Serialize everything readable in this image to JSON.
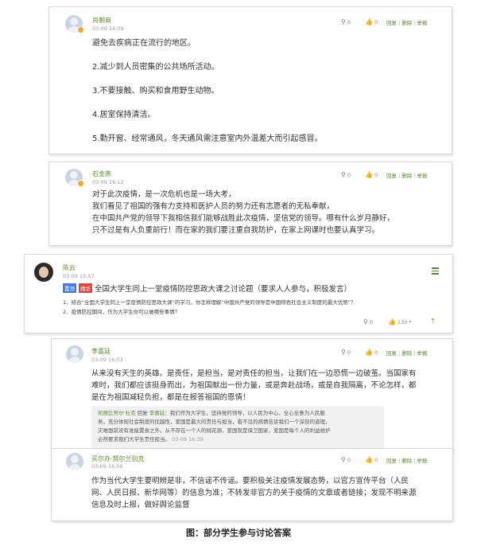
{
  "comments": [
    {
      "user": "肖朝商",
      "time": "03-09 16:09",
      "share_count": "0",
      "like_count": "0",
      "lines": [
        "避免去疾病正在流行的地区。",
        "2.减少到人员密集的公共场所活动。",
        "3.不要接触、购买和食用野生动物。",
        "4.居室保持清洁。",
        "5.勤开窗、经常通风，冬天通风需注意室内外温差大而引起感冒。"
      ]
    },
    {
      "user": "石金燕",
      "time": "03-09 16:12",
      "share_count": "0",
      "like_count": "0",
      "lines": [
        "对于此次疫情，是一次危机也是一场大考，",
        "我们看见了祖国的强有力支持和医护人员的努力还有志愿者的无私奉献，",
        "在中国共产党的领导下我相信我们能够战胜此次疫情，坚信党的领导。哪有什么岁月静好，",
        "只不过是有人负重前行！而在家的我们要注重自我防护，在家上网课时也要认真学习。"
      ]
    }
  ],
  "topic": {
    "user": "陈云",
    "time": "03-09 15:57",
    "tag_top": "置顶",
    "tag_hot": "精华",
    "title": "全国大学生同上一堂疫情防控思政大课之讨论题（要求人人参与，积极发言）",
    "desc1": "1、结合“全国大学生同上一堂疫情防控思政大课”的学习，你怎样理解“中国共产党的领导是中国特色社会主义制度的最大优势”？",
    "desc2": "2、疫情防控期间，作为大学生你可以做哪些事情？",
    "share_count": "0",
    "like_count": "130"
  },
  "replies": [
    {
      "user": "李喜廷",
      "time": "03-09 16:03",
      "share_count": "0",
      "like_count": "0",
      "lines": [
        "从来没有天生的英雄。是责任，是担当，是对责任的担当，让我们在一边恐慌一边破茧。当国家有",
        "难时，我们都应该挺身而出，为祖国献出一份力量，或是奔赴战场，或是自我隔离，不论怎样，都",
        "是在为祖国减轻负担，都是在报答祖国的恩情！"
      ],
      "quote": {
        "name": "凯丽比努尔·杜克",
        "reply_word": "回复",
        "target": "李喜廷",
        "text_lines": [
          "：我们作为大学生，坚持党的领导，以人民为中心，全心全意为人民服",
          "务，充分体现社会制度的优越性，爱国是最大的责任与担当，看不见的病情告诉我们一个深刻的道理，",
          "灾难面前没有谁能置身之外。从不存在一个人的桃花源，爱国就是保卫国家，爱国是每个人的利益维护",
          "必然要求我们大学生责任担当。"
        ],
        "time": "03-09 16:39"
      }
    },
    {
      "user": "买尔办·努尔兰别克",
      "time": "03-09 16:06",
      "share_count": "0",
      "like_count": "0",
      "lines": [
        "作为当代大学生要明辨是非，不信谣不传谣。要积极关注疫情发展态势，以官方宣传平台（人民",
        "网、人民日报、新华网等）的信息为准；不转发非官方的关于疫情的文章或者链接；发现不明来源",
        "信息及时上报，做好舆论监督"
      ]
    }
  ],
  "actions": {
    "reply": "回复",
    "delete": "删除",
    "report": "举报"
  },
  "caption": "图：部分学生参与讨论答案",
  "icons": {
    "share": "share-icon",
    "like": "thumb-up-icon",
    "menu": "menu-icon",
    "up": "arrow-up-icon"
  },
  "colors": {
    "accent_green": "#5b8a2e",
    "tag_blue": "#3f7fd6",
    "tag_red": "#e0483e"
  }
}
